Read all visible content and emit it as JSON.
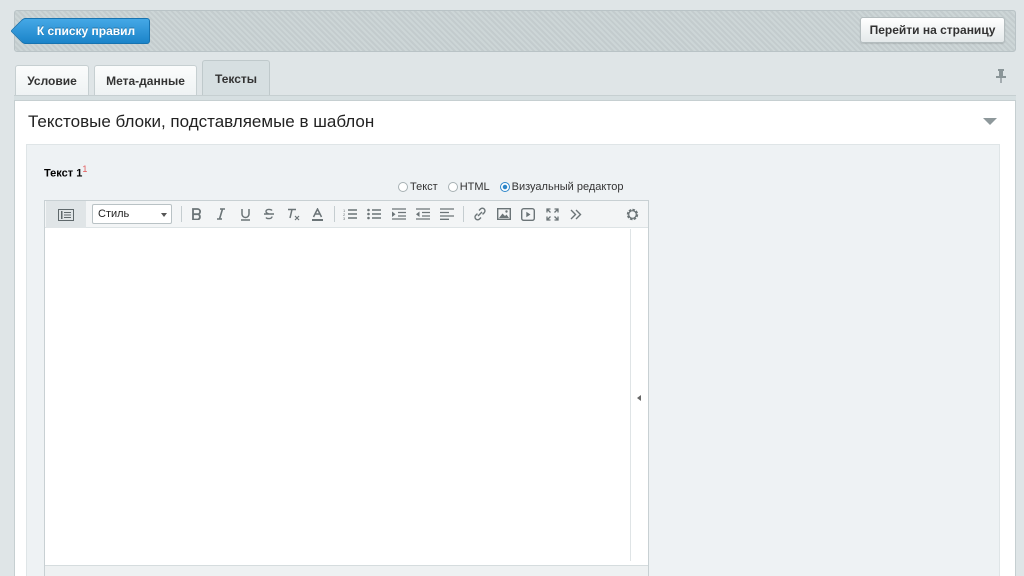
{
  "header": {
    "back_label": "К списку правил",
    "goto_label": "Перейти на страницу"
  },
  "tabs": [
    {
      "label": "Условие",
      "active": false
    },
    {
      "label": "Мета-данные",
      "active": false
    },
    {
      "label": "Тексты",
      "active": true
    }
  ],
  "section": {
    "title": "Текстовые блоки, подставляемые в шаблон"
  },
  "field": {
    "label": "Текст 1",
    "footnote": "1",
    "modes": [
      {
        "label": "Текст",
        "selected": false
      },
      {
        "label": "HTML",
        "selected": false
      },
      {
        "label": "Визуальный редактор",
        "selected": true
      }
    ]
  },
  "editor": {
    "style_select_value": "Стиль",
    "toolbar_icons": [
      "bold-icon",
      "italic-icon",
      "underline-icon",
      "strikethrough-icon",
      "remove-format-icon",
      "text-color-icon",
      "ordered-list-icon",
      "unordered-list-icon",
      "indent-icon",
      "outdent-icon",
      "align-left-icon",
      "link-icon",
      "image-icon",
      "video-icon",
      "fullscreen-icon",
      "more-icon",
      "settings-icon"
    ],
    "content": ""
  },
  "colors": {
    "accent": "#1b84c9",
    "background": "#dfe5e7",
    "required_mark": "#e35b5b"
  }
}
